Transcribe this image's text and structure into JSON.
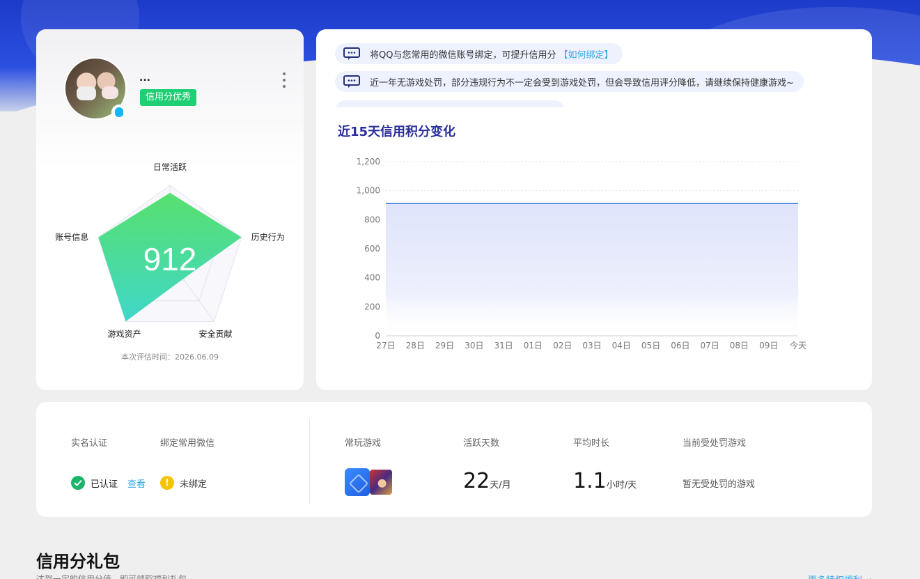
{
  "profile": {
    "nickname": "...",
    "credit_tag": "信用分优秀",
    "score": "912",
    "radar_labels": [
      "日常活跃",
      "历史行为",
      "安全贡献",
      "游戏资产",
      "账号信息"
    ],
    "eval_time": "本次评估时间：2026.06.09"
  },
  "notices": [
    {
      "text": "将QQ与您常用的微信账号绑定，可提升信用分",
      "link": "【如何绑定】"
    },
    {
      "text": "近一年无游戏处罚，部分违规行为不一定会受到游戏处罚，但会导致信用评分降低，请继续保持健康游戏~",
      "link": ""
    }
  ],
  "chart_title": "近15天信用积分变化",
  "chart_data": {
    "type": "area",
    "categories": [
      "27日",
      "28日",
      "29日",
      "30日",
      "31日",
      "01日",
      "02日",
      "03日",
      "04日",
      "05日",
      "06日",
      "07日",
      "08日",
      "09日",
      "今天"
    ],
    "series": [
      {
        "values": [
          912,
          912,
          912,
          912,
          912,
          912,
          912,
          912,
          912,
          912,
          912,
          912,
          912,
          912,
          912
        ]
      }
    ],
    "ylim": [
      0,
      1200
    ],
    "yticks": [
      "0",
      "200",
      "400",
      "600",
      "800",
      "1,000",
      "1,200"
    ],
    "grid": true,
    "line_color": "#5b8fe0",
    "fill_color": "#dfe4fb"
  },
  "stats": {
    "real_name_label": "实名认证",
    "wechat_label": "绑定常用微信",
    "verified_text": "已认证",
    "view_link": "查看",
    "unbound_text": "未绑定",
    "games_label": "常玩游戏",
    "active_days_label": "活跃天数",
    "active_days_value": "22",
    "active_days_unit": "天/月",
    "avg_time_label": "平均时长",
    "avg_time_value": "1.1",
    "avg_time_unit": "小时/天",
    "punish_label": "当前受处罚游戏",
    "punish_text": "暂无受处罚的游戏"
  },
  "gift": {
    "title": "信用分礼包",
    "subtitle": "达到一定的信用分值，即可领取福利礼包",
    "more": "更多特权福利 →"
  },
  "colors": {
    "accent_green": "#1ecf73",
    "link_blue": "#2fa8e8",
    "title_navy": "#2b2f9a"
  }
}
